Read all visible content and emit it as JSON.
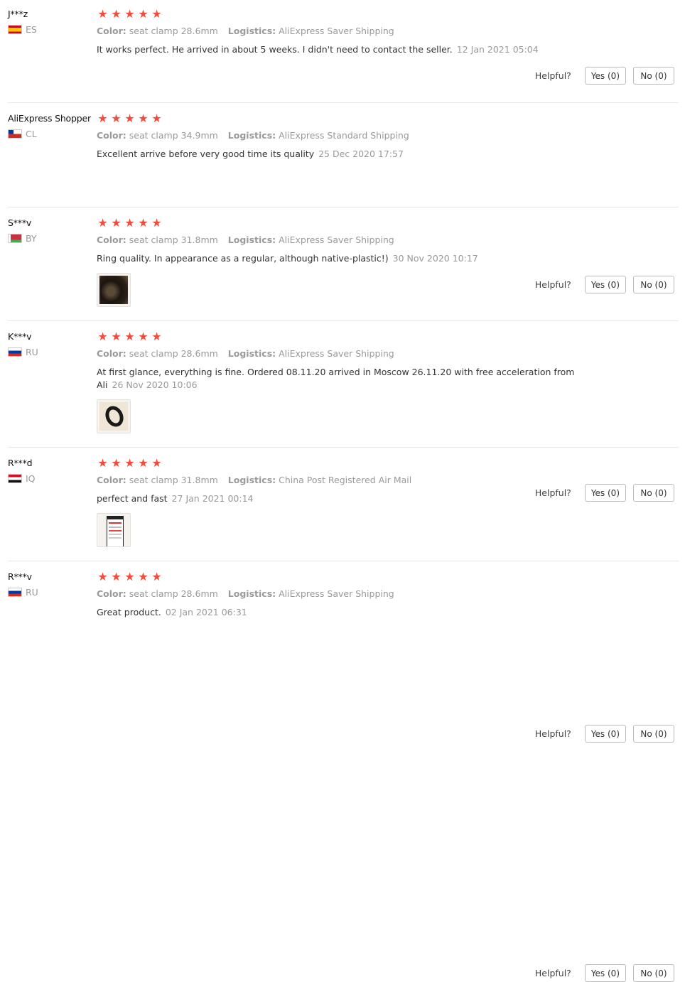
{
  "helpful_label": "Helpful?",
  "meta_labels": {
    "color": "Color:",
    "logistics": "Logistics:"
  },
  "reviews": [
    {
      "user": "J***z",
      "country": "ES",
      "rating": 5,
      "color": "seat clamp 28.6mm",
      "logistics": "AliExpress Saver Shipping",
      "text": "It works perfect. He arrived in about 5 weeks. I didn't need to contact the seller.",
      "date": "12 Jan 2021 05:04",
      "yes": "Yes (0)",
      "no": "No (0)",
      "flag": "flag-es",
      "has_photo": false
    },
    {
      "user": "AliExpress Shopper",
      "country": "CL",
      "rating": 5,
      "color": "seat clamp 34.9mm",
      "logistics": "AliExpress Standard Shipping",
      "text": "Excellent arrive before very good time its quality",
      "date": "25 Dec 2020 17:57",
      "yes": "Yes (0)",
      "no": "No (0)",
      "flag": "flag-cl",
      "has_photo": false
    },
    {
      "user": "S***v",
      "country": "BY",
      "rating": 5,
      "color": "seat clamp 31.8mm",
      "logistics": "AliExpress Saver Shipping",
      "text": "Ring quality. In appearance as a regular, although native-plastic!)",
      "date": "30 Nov 2020 10:17",
      "yes": "Yes (0)",
      "no": "No (0)",
      "flag": "flag-by",
      "has_photo": true
    },
    {
      "user": "K***v",
      "country": "RU",
      "rating": 5,
      "color": "seat clamp 28.6mm",
      "logistics": "AliExpress Saver Shipping",
      "text": "At first glance, everything is fine. Ordered 08.11.20 arrived in Moscow 26.11.20 with free acceleration from Ali",
      "date": "26 Nov 2020 10:06",
      "yes": "Yes (0)",
      "no": "No (0)",
      "flag": "flag-ru",
      "has_photo": true
    },
    {
      "user": "R***d",
      "country": "IQ",
      "rating": 5,
      "color": "seat clamp 31.8mm",
      "logistics": "China Post Registered Air Mail",
      "text": "perfect and fast",
      "date": "27 Jan 2021 00:14",
      "yes": "Yes (0)",
      "no": "No (0)",
      "flag": "flag-iq",
      "has_photo": true
    },
    {
      "user": "R***v",
      "country": "RU",
      "rating": 5,
      "color": "seat clamp 28.6mm",
      "logistics": "AliExpress Saver Shipping",
      "text": "Great product.",
      "date": "02 Jan 2021 06:31",
      "yes": "Yes (0)",
      "no": "No (0)",
      "flag": "flag-ru",
      "has_photo": false
    }
  ]
}
